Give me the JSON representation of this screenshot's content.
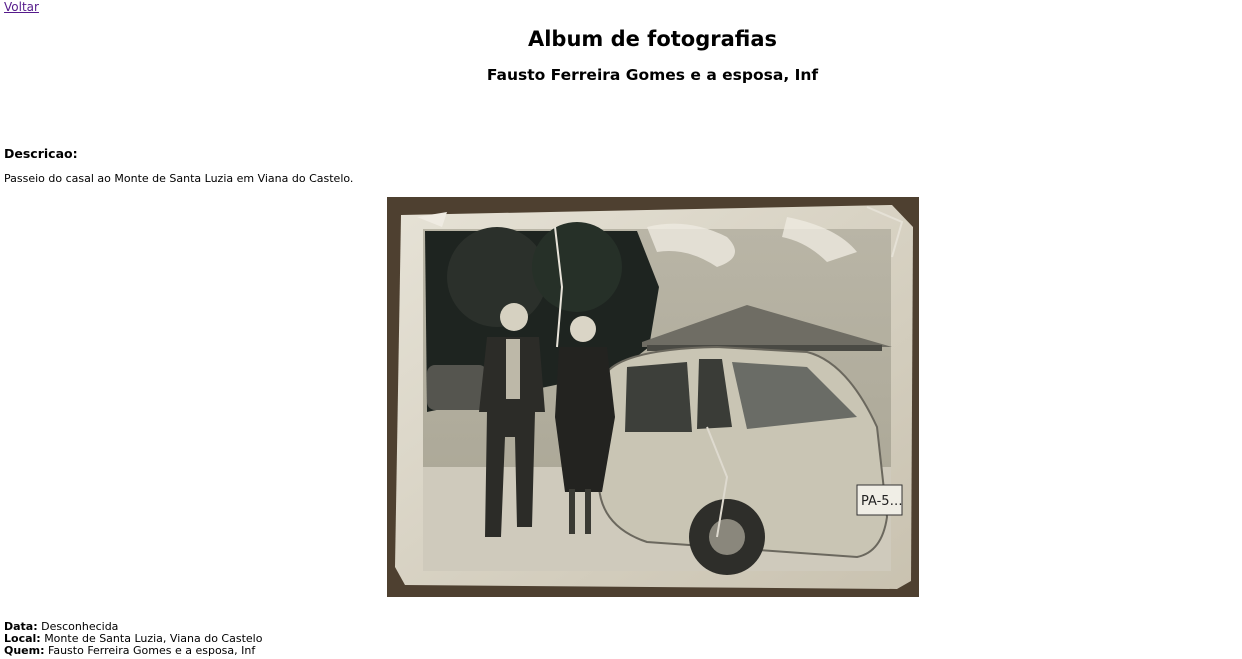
{
  "nav": {
    "back_label": "Voltar"
  },
  "header": {
    "title": "Album de fotografias",
    "subtitle": "Fausto Ferreira Gomes e a esposa, Inf"
  },
  "description": {
    "heading": "Descricao:",
    "text": "Passeio do casal ao Monte de Santa Luzia em Viana do Castelo."
  },
  "photo": {
    "plate_text": "PA-5…"
  },
  "details": {
    "data_label": "Data:",
    "data_value": "Desconhecida",
    "local_label": "Local:",
    "local_value": "Monte de Santa Luzia, Viana do Castelo",
    "quem_label": "Quem:",
    "quem_value": "Fausto Ferreira Gomes e a esposa, Inf"
  },
  "colors": {
    "link": "#551a8b",
    "photo_border": "#5a4a3a",
    "photo_paper": "#d8d3c4"
  }
}
